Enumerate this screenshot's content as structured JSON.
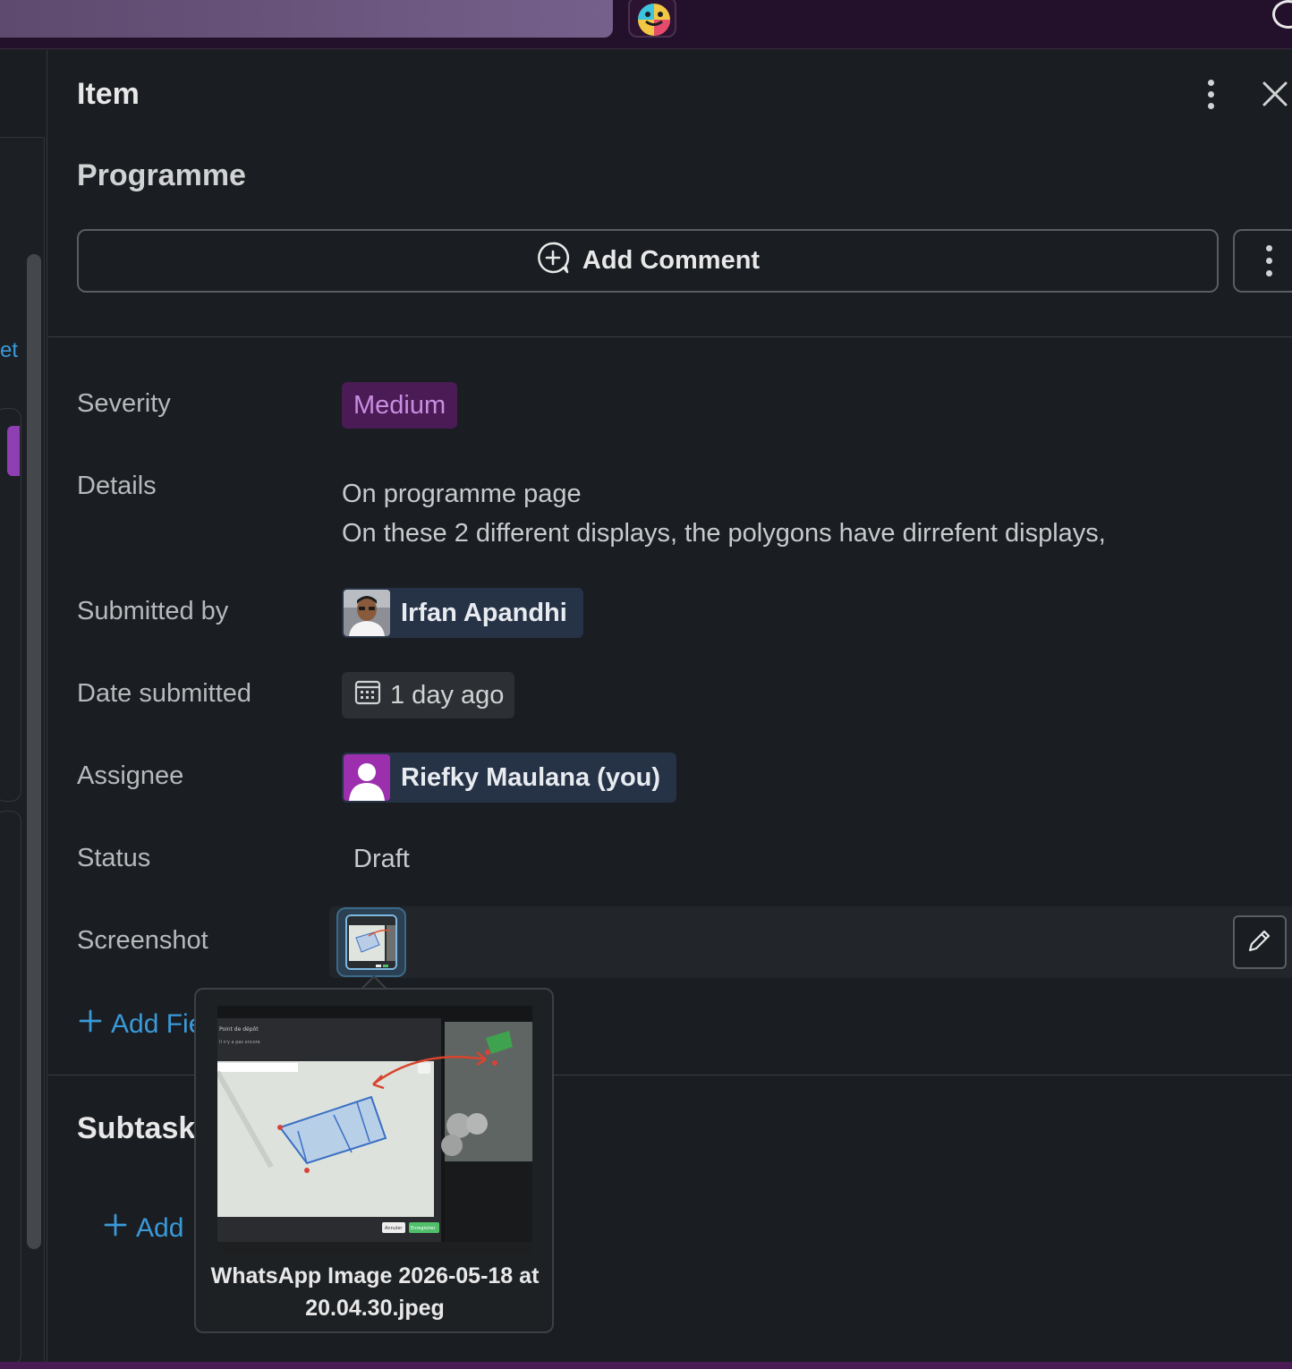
{
  "panel": {
    "title": "Item",
    "item_name": "Programme",
    "add_comment_label": "Add Comment"
  },
  "left_rail": {
    "partial_link": "et"
  },
  "fields": {
    "severity": {
      "label": "Severity",
      "value": "Medium",
      "color": "#4a1b55"
    },
    "details": {
      "label": "Details",
      "line1": "On programme page",
      "line2": "On these 2 different displays, the polygons have dirrefent displays,"
    },
    "submitted_by": {
      "label": "Submitted by",
      "value": "Irfan Apandhi"
    },
    "date_submitted": {
      "label": "Date submitted",
      "value": "1 day ago"
    },
    "assignee": {
      "label": "Assignee",
      "value": "Riefky Maulana (you)"
    },
    "status": {
      "label": "Status",
      "value": "Draft"
    },
    "screenshot": {
      "label": "Screenshot"
    }
  },
  "add_field_label": "Add Fie",
  "subtasks": {
    "title": "Subtask",
    "add_label": "Add"
  },
  "preview": {
    "filename": "WhatsApp Image 2026-05-18 at 20.04.30.jpeg",
    "dialog_title": "Point de dépôt",
    "dialog_sub": "Il n'y a pas encore",
    "cancel": "Annuler",
    "save": "Enregistrer"
  },
  "colors": {
    "accent_link": "#3a9ad9",
    "topbar": "#23102a",
    "background": "#1a1d21"
  }
}
